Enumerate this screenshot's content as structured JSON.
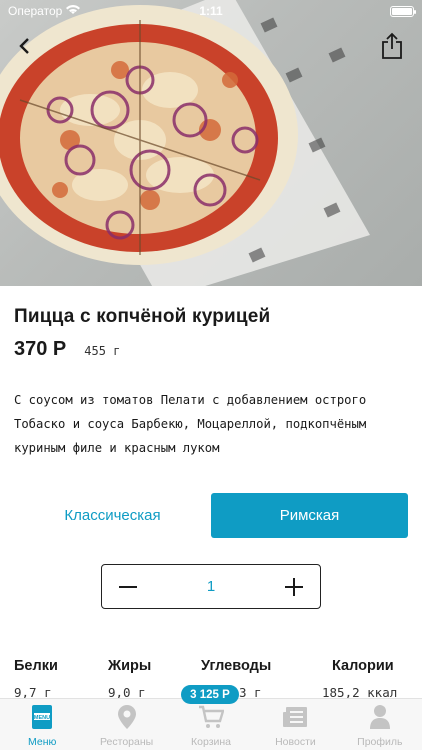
{
  "status_bar": {
    "carrier": "Оператор",
    "time": "1:11"
  },
  "product": {
    "title": "Пицца с копчёной курицей",
    "price": "370 Р",
    "weight": "455 г",
    "description": "С соусом из томатов Пелати с добавлением острого Тобаско и соуса Барбекю, Моцареллой, подкопчёным куриным филе и красным луком"
  },
  "dough_options": [
    {
      "label": "Классическая",
      "selected": false
    },
    {
      "label": "Римская",
      "selected": true
    }
  ],
  "stepper": {
    "quantity": "1"
  },
  "nutrition": [
    {
      "label": "Белки",
      "value": "9,7 г"
    },
    {
      "label": "Жиры",
      "value": "9,0 г"
    },
    {
      "label": "Углеводы",
      "value": "3 г"
    },
    {
      "label": "Калории",
      "value": "185,2 ккал"
    }
  ],
  "cart_badge": "3 125 Р",
  "tabs": [
    {
      "label": "Меню",
      "icon": "menu-icon",
      "active": true
    },
    {
      "label": "Рестораны",
      "icon": "location-pin-icon",
      "active": false
    },
    {
      "label": "Корзина",
      "icon": "cart-icon",
      "active": false
    },
    {
      "label": "Новости",
      "icon": "newspaper-icon",
      "active": false
    },
    {
      "label": "Профиль",
      "icon": "user-icon",
      "active": false
    }
  ],
  "colors": {
    "accent": "#0f9cc4",
    "inactive_tab": "#b9b9b9"
  }
}
